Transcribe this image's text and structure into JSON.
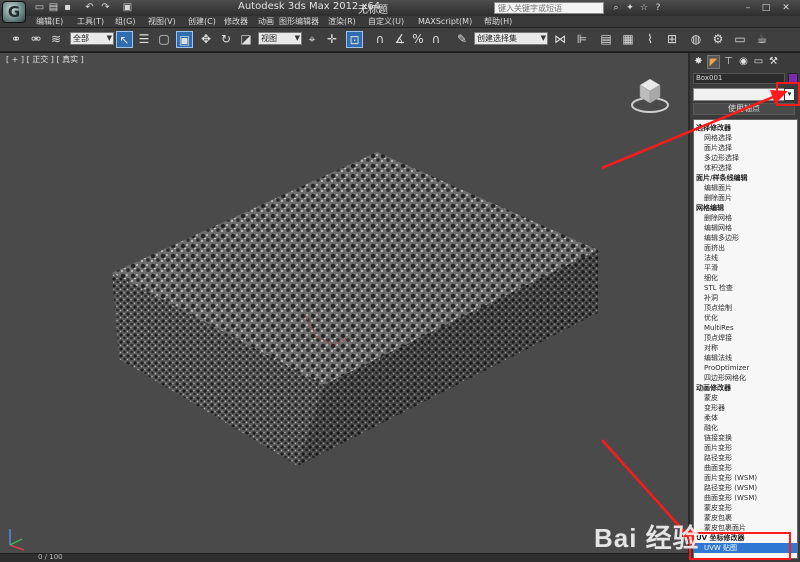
{
  "window": {
    "app_name": "Autodesk 3ds Max  2012 x64",
    "doc_title": "无标题",
    "search_placeholder": "键入关键字或短语"
  },
  "menubar": [
    "编辑(E)",
    "工具(T)",
    "组(G)",
    "视图(V)",
    "创建(C)",
    "修改器",
    "动画",
    "图形编辑器",
    "渲染(R)",
    "自定义(U)",
    "MAXScript(M)",
    "帮助(H)"
  ],
  "toolbar": {
    "filter_dropdown": "全部",
    "refcoord_dropdown": "视图",
    "selection_set_dropdown": "创建选择集"
  },
  "viewport": {
    "label": "[ + ] [ 正交 ] [ 真实 ]"
  },
  "timeline": {
    "frame_readout": "0 / 100"
  },
  "command_panel": {
    "object_name": "Box001",
    "object_color": "#7c2bb0",
    "modifier_list_arrow": "▾",
    "pivot_button": "使用轴点",
    "groups": [
      {
        "title": "选择修改器",
        "items": [
          "网格选择",
          "面片选择",
          "多边形选择",
          "体积选择"
        ]
      },
      {
        "title": "面片/样条线编辑",
        "items": [
          "编辑面片",
          "删除面片"
        ]
      },
      {
        "title": "网格编辑",
        "items": [
          "删除网格",
          "编辑网格",
          "编辑多边形",
          "面挤出",
          "法线",
          "平滑",
          "细化",
          "STL 检查",
          "补洞",
          "顶点绘制",
          "优化",
          "MultiRes",
          "顶点焊接",
          "对称",
          "编辑法线",
          "ProOptimizer",
          "四边形网格化"
        ]
      },
      {
        "title": "动画修改器",
        "items": [
          "蒙皮",
          "变形器",
          "柔体",
          "融化",
          "链接变换",
          "面片变形",
          "路径变形",
          "曲面变形",
          "面片变形 (WSM)",
          "路径变形 (WSM)",
          "曲面变形 (WSM)",
          "蒙皮变形",
          "蒙皮包裹",
          "蒙皮包裹面片"
        ]
      },
      {
        "title": "UV 坐标修改器",
        "items": [
          "UVW 贴图"
        ]
      }
    ],
    "selected_item": "UVW 贴图"
  },
  "watermark": "Bai 经验",
  "annotation_color": "#ff1a1a"
}
